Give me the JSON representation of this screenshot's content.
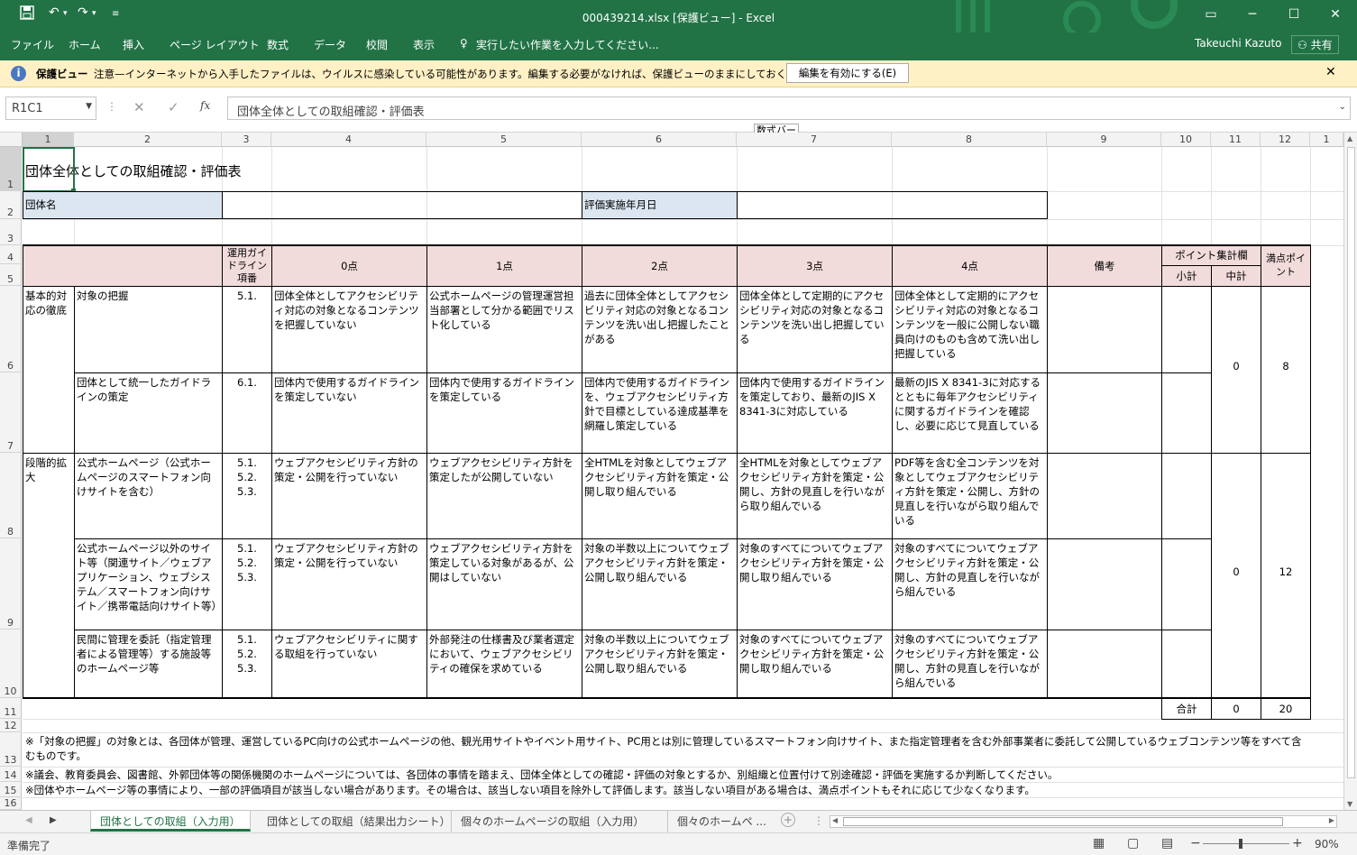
{
  "window": {
    "title": "000439214.xlsx [保護ビュー] - Excel",
    "user": "Takeuchi Kazuto",
    "share": "共有"
  },
  "ribbon": {
    "tabs": [
      "ファイル",
      "ホーム",
      "挿入",
      "ページ レイアウト",
      "数式",
      "データ",
      "校閲",
      "表示"
    ],
    "tell_me": "実行したい作業を入力してください..."
  },
  "protected": {
    "label": "保護ビュー",
    "message": "注意—インターネットから入手したファイルは、ウイルスに感染している可能性があります。編集する必要がなければ、保護ビューのままにしておくことをお勧めします。",
    "enable_button": "編集を有効にする(E)"
  },
  "formula_bar": {
    "name_box": "R1C1",
    "fx": "fx",
    "formula": "団体全体としての取組確認・評価表",
    "tooltip": "数式バー"
  },
  "columns": [
    "1",
    "2",
    "3",
    "4",
    "5",
    "6",
    "7",
    "8",
    "9",
    "10",
    "11",
    "12",
    "1"
  ],
  "rows": [
    "1",
    "2",
    "3",
    "4",
    "5",
    "6",
    "7",
    "8",
    "9",
    "10",
    "11",
    "12",
    "13",
    "14",
    "15",
    "16"
  ],
  "sheet": {
    "title": "団体全体としての取組確認・評価表",
    "org_label": "団体名",
    "date_label": "評価実施年月日",
    "headers": {
      "guide": "運用ガイドライン項番",
      "p0": "0点",
      "p1": "1点",
      "p2": "2点",
      "p3": "3点",
      "p4": "4点",
      "notes": "備考",
      "points": "ポイント集計欄",
      "subtotal": "小計",
      "midtotal": "中計",
      "max": "満点ポイント"
    },
    "cat1": "基本的対応の徹底",
    "cat2": "段階的拡大",
    "r6": {
      "item": "対象の把握",
      "guide": "5.1.",
      "p0": "団体全体としてアクセシビリティ対応の対象となるコンテンツを把握していない",
      "p1": "公式ホームページの管理運営担当部署として分かる範囲でリスト化している",
      "p2": "過去に団体全体としてアクセシビリティ対応の対象となるコンテンツを洗い出し把握したことがある",
      "p3": "団体全体として定期的にアクセシビリティ対応の対象となるコンテンツを洗い出し把握している",
      "p4": "団体全体として定期的にアクセシビリティ対応の対象となるコンテンツを一般に公開しない職員向けのものも含めて洗い出し把握している"
    },
    "r7": {
      "item": "団体として統一したガイドラインの策定",
      "guide": "6.1.",
      "p0": "団体内で使用するガイドラインを策定していない",
      "p1": "団体内で使用するガイドラインを策定している",
      "p2": "団体内で使用するガイドラインを、ウェブアクセシビリティ方針で目標としている達成基準を網羅し策定している",
      "p3": "団体内で使用するガイドラインを策定しており、最新のJIS X 8341-3に対応している",
      "p4": "最新のJIS X 8341-3に対応するとともに毎年アクセシビリティに関するガイドラインを確認し、必要に応じて見直している"
    },
    "r8": {
      "item": "公式ホームページ（公式ホームページのスマートフォン向けサイトを含む）",
      "guide": "5.1.\n5.2.\n5.3.",
      "p0": "ウェブアクセシビリティ方針の策定・公開を行っていない",
      "p1": "ウェブアクセシビリティ方針を策定したが公開していない",
      "p2": "全HTMLを対象としてウェブアクセシビリティ方針を策定・公開し取り組んでいる",
      "p3": "全HTMLを対象としてウェブアクセシビリティ方針を策定・公開し、方針の見直しを行いながら取り組んでいる",
      "p4": "PDF等を含む全コンテンツを対象としてウェブアクセシビリティ方針を策定・公開し、方針の見直しを行いながら取り組んでいる"
    },
    "r9": {
      "item": "公式ホームページ以外のサイト等（関連サイト／ウェブアプリケーション、ウェブシステム／スマートフォン向けサイト／携帯電話向けサイト等）",
      "guide": "5.1.\n5.2.\n5.3.",
      "p0": "ウェブアクセシビリティ方針の策定・公開を行っていない",
      "p1": "ウェブアクセシビリティ方針を策定している対象があるが、公開はしていない",
      "p2": "対象の半数以上についてウェブアクセシビリティ方針を策定・公開し取り組んでいる",
      "p3": "対象のすべてについてウェブアクセシビリティ方針を策定・公開し取り組んでいる",
      "p4": "対象のすべてについてウェブアクセシビリティ方針を策定・公開し、方針の見直しを行いながら組んでいる"
    },
    "r10": {
      "item": "民間に管理を委託（指定管理者による管理等）する施設等のホームページ等",
      "guide": "5.1.\n5.2.\n5.3.",
      "p0": "ウェブアクセシビリティに関する取組を行っていない",
      "p1": "外部発注の仕様書及び業者選定において、ウェブアクセシビリティの確保を求めている",
      "p2": "対象の半数以上についてウェブアクセシビリティ方針を策定・公開し取り組んでいる",
      "p3": "対象のすべてについてウェブアクセシビリティ方針を策定・公開し取り組んでいる",
      "p4": "対象のすべてについてウェブアクセシビリティ方針を策定・公開し、方針の見直しを行いながら組んでいる"
    },
    "mid1": "0",
    "max1": "8",
    "mid2": "0",
    "max2": "12",
    "total_label": "合計",
    "total_mid": "0",
    "total_max": "20",
    "note13": "※「対象の把握」の対象とは、各団体が管理、運営しているPC向けの公式ホームページの他、観光用サイトやイベント用サイト、PC用とは別に管理しているスマートフォン向けサイト、また指定管理者を含む外部事業者に委託して公開しているウェブコンテンツ等をすべて含むものです。",
    "note14": "※議会、教育委員会、図書館、外郭団体等の関係機関のホームページについては、各団体の事情を踏まえ、団体全体としての確認・評価の対象とするか、別組織と位置付けて別途確認・評価を実施するか判断してください。",
    "note15": "※団体やホームページ等の事情により、一部の評価項目が該当しない場合があります。その場合は、該当しない項目を除外して評価します。該当しない項目がある場合は、満点ポイントもそれに応じて少なくなります。"
  },
  "sheet_tabs": [
    "団体としての取組（入力用）",
    "団体としての取組（結果出力シート）",
    "個々のホームページの取組（入力用）",
    "個々のホームペ ..."
  ],
  "status": {
    "ready": "準備完了",
    "zoom": "90%"
  }
}
